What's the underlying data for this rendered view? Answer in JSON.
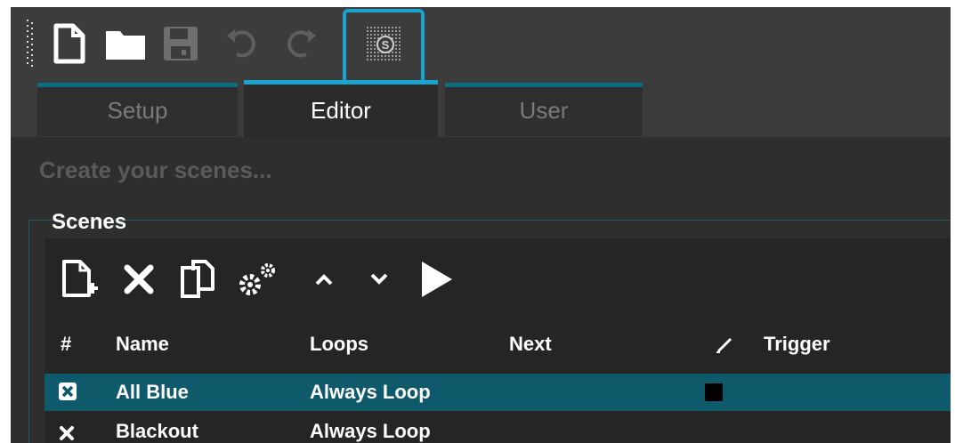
{
  "toolbar": {
    "buttons": [
      {
        "name": "new-file-button",
        "icon": "new-file-icon",
        "enabled": true
      },
      {
        "name": "open-folder-button",
        "icon": "folder-icon",
        "enabled": true
      },
      {
        "name": "save-button",
        "icon": "save-icon",
        "enabled": false
      },
      {
        "name": "undo-button",
        "icon": "undo-icon",
        "enabled": false
      },
      {
        "name": "redo-button",
        "icon": "redo-icon",
        "enabled": false
      },
      {
        "name": "fixture-library-button",
        "icon": "fixture-library-icon",
        "enabled": true,
        "highlighted": true
      }
    ]
  },
  "tabs": [
    {
      "label": "Setup",
      "active": false
    },
    {
      "label": "Editor",
      "active": true
    },
    {
      "label": "User",
      "active": false
    }
  ],
  "editor": {
    "subtitle": "Create your scenes...",
    "scenes": {
      "title": "Scenes",
      "actions": [
        {
          "name": "add-scene-button",
          "icon": "add-file-icon"
        },
        {
          "name": "delete-scene-button",
          "icon": "delete-icon"
        },
        {
          "name": "duplicate-scene-button",
          "icon": "duplicate-icon"
        },
        {
          "name": "scene-settings-button",
          "icon": "gears-icon"
        },
        {
          "name": "move-up-button",
          "icon": "chevron-up-icon"
        },
        {
          "name": "move-down-button",
          "icon": "chevron-down-icon"
        },
        {
          "name": "play-scene-button",
          "icon": "play-icon"
        }
      ],
      "columns": {
        "index": "#",
        "name": "Name",
        "loops": "Loops",
        "next": "Next",
        "edit": "pen-icon",
        "trigger": "Trigger"
      },
      "rows": [
        {
          "name": "All Blue",
          "loops": "Always Loop",
          "next": "",
          "trigger": "",
          "has_color": true,
          "selected": true
        },
        {
          "name": "Blackout",
          "loops": "Always Loop",
          "next": "",
          "trigger": "",
          "has_color": false,
          "selected": false
        }
      ]
    }
  },
  "colors": {
    "accent": "#1aa3d1",
    "selected_row": "#0e5a6b",
    "background": "#2e2e2e"
  }
}
